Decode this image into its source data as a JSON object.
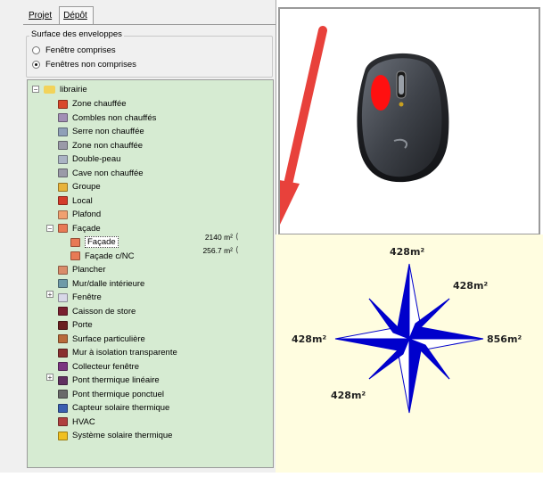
{
  "tabs": [
    {
      "label": "Projet",
      "accel": "P"
    },
    {
      "label": "Dépôt",
      "accel": "D"
    }
  ],
  "envelope_surface": {
    "title": "Surface des enveloppes",
    "options": [
      {
        "label": "Fenêtre comprises",
        "checked": false
      },
      {
        "label": "Fenêtres non comprises",
        "checked": true
      }
    ]
  },
  "tree": {
    "root": {
      "label": "librairie"
    },
    "items": [
      {
        "label": "Zone chauffée",
        "icon": "heated-zone-icon",
        "color": "#d9482b"
      },
      {
        "label": "Combles non chauffés",
        "icon": "unheated-attic-icon",
        "color": "#a28fb5"
      },
      {
        "label": "Serre non chauffée",
        "icon": "greenhouse-icon",
        "color": "#8fa0b8"
      },
      {
        "label": "Zone non chauffée",
        "icon": "unheated-zone-icon",
        "color": "#9a9aa8"
      },
      {
        "label": "Double-peau",
        "icon": "double-skin-icon",
        "color": "#aab4c4"
      },
      {
        "label": "Cave non chauffée",
        "icon": "cellar-icon",
        "color": "#9a9aa8"
      },
      {
        "label": "Groupe",
        "icon": "group-icon",
        "color": "#e8b33a"
      },
      {
        "label": "Local",
        "icon": "room-icon",
        "color": "#d43b2a"
      },
      {
        "label": "Plafond",
        "icon": "ceiling-icon",
        "color": "#f0a070"
      },
      {
        "label": "Façade",
        "icon": "facade-icon",
        "color": "#e87a55"
      },
      {
        "label": "Façade",
        "icon": "facade-icon",
        "color": "#e87a55",
        "area": "2140 m²",
        "selected": true
      },
      {
        "label": "Façade c/NC",
        "icon": "facade-icon",
        "color": "#e87a55",
        "area": "256.7 m²"
      },
      {
        "label": "Plancher",
        "icon": "floor-icon",
        "color": "#d98c6a"
      },
      {
        "label": "Mur/dalle intérieure",
        "icon": "inner-wall-icon",
        "color": "#6f9aa8"
      },
      {
        "label": "Fenêtre",
        "icon": "window-icon",
        "color": "#d8d8e8"
      },
      {
        "label": "Caisson de store",
        "icon": "blind-box-icon",
        "color": "#7a2030"
      },
      {
        "label": "Porte",
        "icon": "door-icon",
        "color": "#6a2020"
      },
      {
        "label": "Surface particulière",
        "icon": "special-surface-icon",
        "color": "#b86a3a"
      },
      {
        "label": "Mur à isolation transparente",
        "icon": "transparent-insulation-icon",
        "color": "#8a3030"
      },
      {
        "label": "Collecteur fenêtre",
        "icon": "window-collector-icon",
        "color": "#7a3580"
      },
      {
        "label": "Pont thermique linéaire",
        "icon": "linear-bridge-icon",
        "color": "#603060"
      },
      {
        "label": "Pont thermique ponctuel",
        "icon": "point-bridge-icon",
        "color": "#6a6a6a"
      },
      {
        "label": "Capteur solaire thermique",
        "icon": "solar-collector-icon",
        "color": "#3a5fb0"
      },
      {
        "label": "HVAC",
        "icon": "hvac-icon",
        "color": "#b04040"
      },
      {
        "label": "Système solaire thermique",
        "icon": "solar-system-icon",
        "color": "#f0c020"
      }
    ]
  },
  "compass": {
    "north": "428m²",
    "northeast": "428m²",
    "east": "856m²",
    "west": "428m²",
    "southwest": "428m²",
    "color": "#0000cc"
  },
  "colors": {
    "tree_bg": "#d6ebd2",
    "compass_bg": "#fffde0",
    "arrow": "#e8413b",
    "mouse_button": "#ff1010"
  }
}
